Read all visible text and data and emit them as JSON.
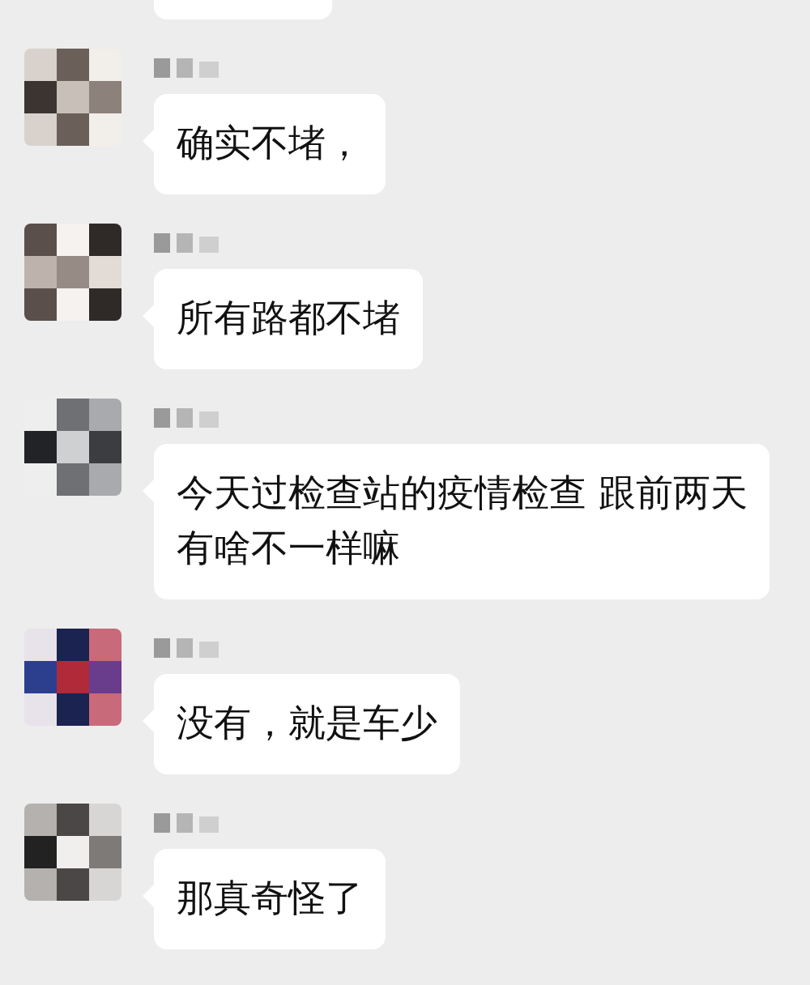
{
  "messages": [
    {
      "lines": [
        "确实不堵，"
      ]
    },
    {
      "lines": [
        "所有路都不堵"
      ]
    },
    {
      "lines": [
        "今天过检查站的疫情检查 跟前两天",
        "有啥不一样嘛"
      ]
    },
    {
      "lines": [
        "没有，就是车少"
      ]
    },
    {
      "lines": [
        "那真奇怪了"
      ]
    }
  ]
}
